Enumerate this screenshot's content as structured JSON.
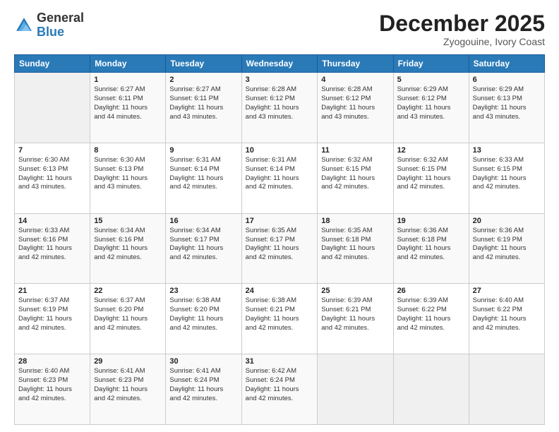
{
  "header": {
    "logo_general": "General",
    "logo_blue": "Blue",
    "month_title": "December 2025",
    "location": "Zyogouine, Ivory Coast"
  },
  "days_of_week": [
    "Sunday",
    "Monday",
    "Tuesday",
    "Wednesday",
    "Thursday",
    "Friday",
    "Saturday"
  ],
  "weeks": [
    [
      {
        "day": "",
        "info": ""
      },
      {
        "day": "1",
        "info": "Sunrise: 6:27 AM\nSunset: 6:11 PM\nDaylight: 11 hours\nand 44 minutes."
      },
      {
        "day": "2",
        "info": "Sunrise: 6:27 AM\nSunset: 6:11 PM\nDaylight: 11 hours\nand 43 minutes."
      },
      {
        "day": "3",
        "info": "Sunrise: 6:28 AM\nSunset: 6:12 PM\nDaylight: 11 hours\nand 43 minutes."
      },
      {
        "day": "4",
        "info": "Sunrise: 6:28 AM\nSunset: 6:12 PM\nDaylight: 11 hours\nand 43 minutes."
      },
      {
        "day": "5",
        "info": "Sunrise: 6:29 AM\nSunset: 6:12 PM\nDaylight: 11 hours\nand 43 minutes."
      },
      {
        "day": "6",
        "info": "Sunrise: 6:29 AM\nSunset: 6:13 PM\nDaylight: 11 hours\nand 43 minutes."
      }
    ],
    [
      {
        "day": "7",
        "info": "Sunrise: 6:30 AM\nSunset: 6:13 PM\nDaylight: 11 hours\nand 43 minutes."
      },
      {
        "day": "8",
        "info": "Sunrise: 6:30 AM\nSunset: 6:13 PM\nDaylight: 11 hours\nand 43 minutes."
      },
      {
        "day": "9",
        "info": "Sunrise: 6:31 AM\nSunset: 6:14 PM\nDaylight: 11 hours\nand 42 minutes."
      },
      {
        "day": "10",
        "info": "Sunrise: 6:31 AM\nSunset: 6:14 PM\nDaylight: 11 hours\nand 42 minutes."
      },
      {
        "day": "11",
        "info": "Sunrise: 6:32 AM\nSunset: 6:15 PM\nDaylight: 11 hours\nand 42 minutes."
      },
      {
        "day": "12",
        "info": "Sunrise: 6:32 AM\nSunset: 6:15 PM\nDaylight: 11 hours\nand 42 minutes."
      },
      {
        "day": "13",
        "info": "Sunrise: 6:33 AM\nSunset: 6:15 PM\nDaylight: 11 hours\nand 42 minutes."
      }
    ],
    [
      {
        "day": "14",
        "info": "Sunrise: 6:33 AM\nSunset: 6:16 PM\nDaylight: 11 hours\nand 42 minutes."
      },
      {
        "day": "15",
        "info": "Sunrise: 6:34 AM\nSunset: 6:16 PM\nDaylight: 11 hours\nand 42 minutes."
      },
      {
        "day": "16",
        "info": "Sunrise: 6:34 AM\nSunset: 6:17 PM\nDaylight: 11 hours\nand 42 minutes."
      },
      {
        "day": "17",
        "info": "Sunrise: 6:35 AM\nSunset: 6:17 PM\nDaylight: 11 hours\nand 42 minutes."
      },
      {
        "day": "18",
        "info": "Sunrise: 6:35 AM\nSunset: 6:18 PM\nDaylight: 11 hours\nand 42 minutes."
      },
      {
        "day": "19",
        "info": "Sunrise: 6:36 AM\nSunset: 6:18 PM\nDaylight: 11 hours\nand 42 minutes."
      },
      {
        "day": "20",
        "info": "Sunrise: 6:36 AM\nSunset: 6:19 PM\nDaylight: 11 hours\nand 42 minutes."
      }
    ],
    [
      {
        "day": "21",
        "info": "Sunrise: 6:37 AM\nSunset: 6:19 PM\nDaylight: 11 hours\nand 42 minutes."
      },
      {
        "day": "22",
        "info": "Sunrise: 6:37 AM\nSunset: 6:20 PM\nDaylight: 11 hours\nand 42 minutes."
      },
      {
        "day": "23",
        "info": "Sunrise: 6:38 AM\nSunset: 6:20 PM\nDaylight: 11 hours\nand 42 minutes."
      },
      {
        "day": "24",
        "info": "Sunrise: 6:38 AM\nSunset: 6:21 PM\nDaylight: 11 hours\nand 42 minutes."
      },
      {
        "day": "25",
        "info": "Sunrise: 6:39 AM\nSunset: 6:21 PM\nDaylight: 11 hours\nand 42 minutes."
      },
      {
        "day": "26",
        "info": "Sunrise: 6:39 AM\nSunset: 6:22 PM\nDaylight: 11 hours\nand 42 minutes."
      },
      {
        "day": "27",
        "info": "Sunrise: 6:40 AM\nSunset: 6:22 PM\nDaylight: 11 hours\nand 42 minutes."
      }
    ],
    [
      {
        "day": "28",
        "info": "Sunrise: 6:40 AM\nSunset: 6:23 PM\nDaylight: 11 hours\nand 42 minutes."
      },
      {
        "day": "29",
        "info": "Sunrise: 6:41 AM\nSunset: 6:23 PM\nDaylight: 11 hours\nand 42 minutes."
      },
      {
        "day": "30",
        "info": "Sunrise: 6:41 AM\nSunset: 6:24 PM\nDaylight: 11 hours\nand 42 minutes."
      },
      {
        "day": "31",
        "info": "Sunrise: 6:42 AM\nSunset: 6:24 PM\nDaylight: 11 hours\nand 42 minutes."
      },
      {
        "day": "",
        "info": ""
      },
      {
        "day": "",
        "info": ""
      },
      {
        "day": "",
        "info": ""
      }
    ]
  ]
}
